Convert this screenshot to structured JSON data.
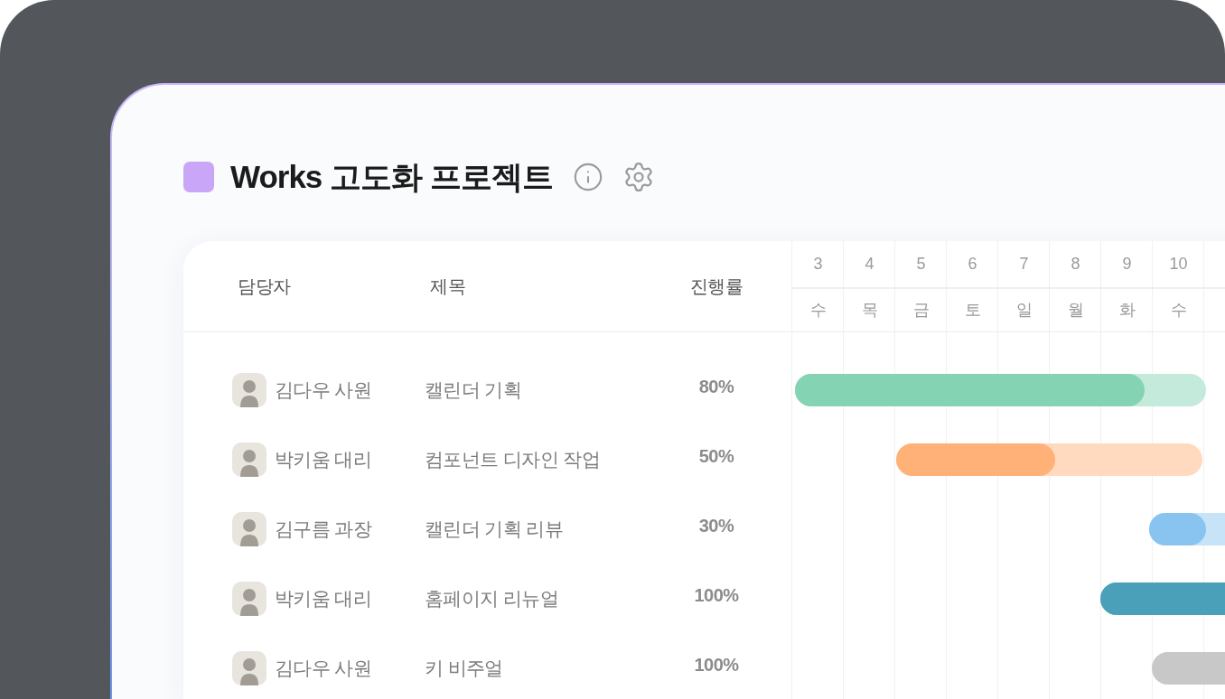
{
  "project": {
    "title": "Works 고도화 프로젝트"
  },
  "table": {
    "columns": [
      "담당자",
      "제목",
      "진행률"
    ],
    "dates": [
      {
        "day": "3",
        "weekday": "수"
      },
      {
        "day": "4",
        "weekday": "목"
      },
      {
        "day": "5",
        "weekday": "금"
      },
      {
        "day": "6",
        "weekday": "토"
      },
      {
        "day": "7",
        "weekday": "일"
      },
      {
        "day": "8",
        "weekday": "월"
      },
      {
        "day": "9",
        "weekday": "화"
      },
      {
        "day": "10",
        "weekday": "수"
      }
    ],
    "rows": [
      {
        "assignee": "김다우 사원",
        "title": "캘린더 기획",
        "progress": "80%",
        "level": 0.85,
        "color": "#84d4b3"
      },
      {
        "assignee": "박키움 대리",
        "title": "컴포넌트 디자인 작업",
        "progress": "50%",
        "level": 0.52,
        "color": "#ffb178"
      },
      {
        "assignee": "김구름 과장",
        "title": "캘린더 기획 리뷰",
        "progress": "30%",
        "level": 0.3,
        "color": "#89c4f0"
      },
      {
        "assignee": "박키움 대리",
        "title": "홈페이지 리뉴얼",
        "progress": "100%",
        "level": 1,
        "color": "#4aa0b8"
      },
      {
        "assignee": "김다우 사원",
        "title": "키 비주얼",
        "progress": "100%",
        "level": 1,
        "color": "#c8c8c8"
      }
    ]
  }
}
